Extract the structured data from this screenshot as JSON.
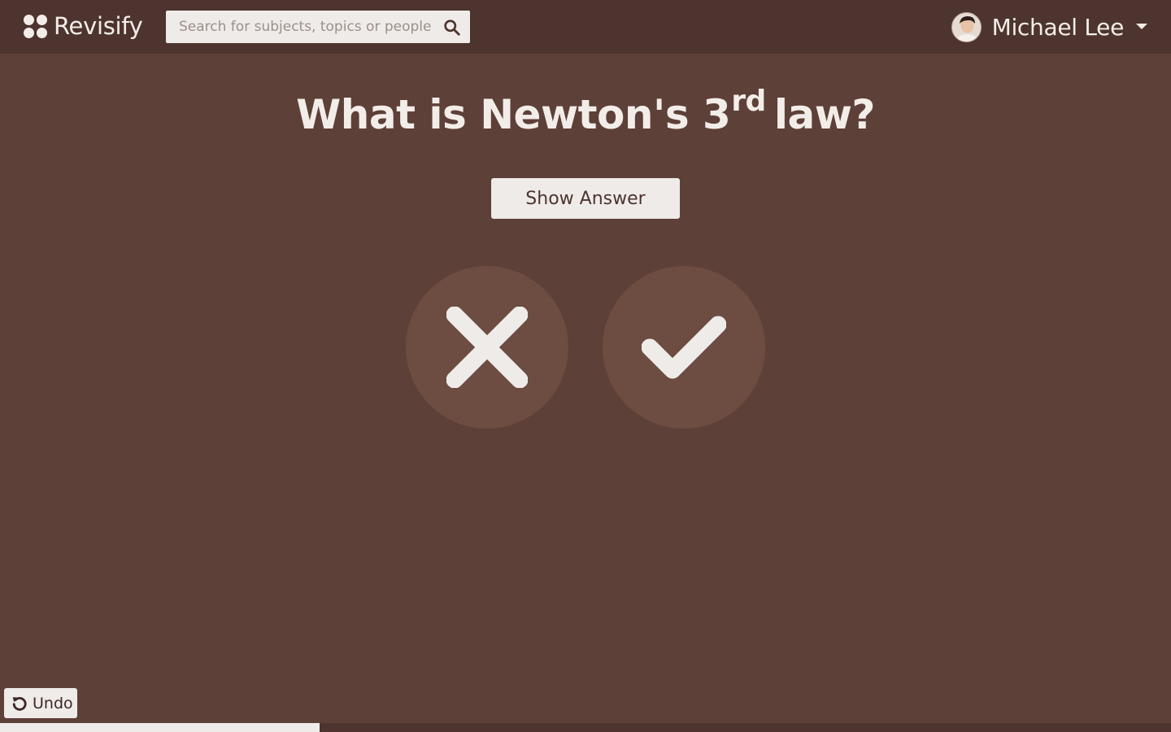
{
  "header": {
    "logo_text": "Revisify",
    "search": {
      "placeholder": "Search for subjects, topics or people",
      "value": ""
    },
    "user": {
      "name": "Michael Lee"
    }
  },
  "card": {
    "question_prefix": "What is Newton's 3",
    "question_superscript": "rd",
    "question_suffix": "law?",
    "show_answer_label": "Show Answer"
  },
  "undo_label": "Undo",
  "progress": {
    "fraction": 0.273
  },
  "icons": {
    "logo": "four-dots-logo-icon",
    "search": "search-icon",
    "avatar": "avatar",
    "dropdown": "chevron-down-icon",
    "wrong": "cross-icon",
    "right": "check-icon",
    "undo": "undo-icon"
  },
  "colors": {
    "background": "#5d4037",
    "topbar": "#4e342e",
    "circle": "#6d4c41",
    "light": "#efebe9"
  }
}
